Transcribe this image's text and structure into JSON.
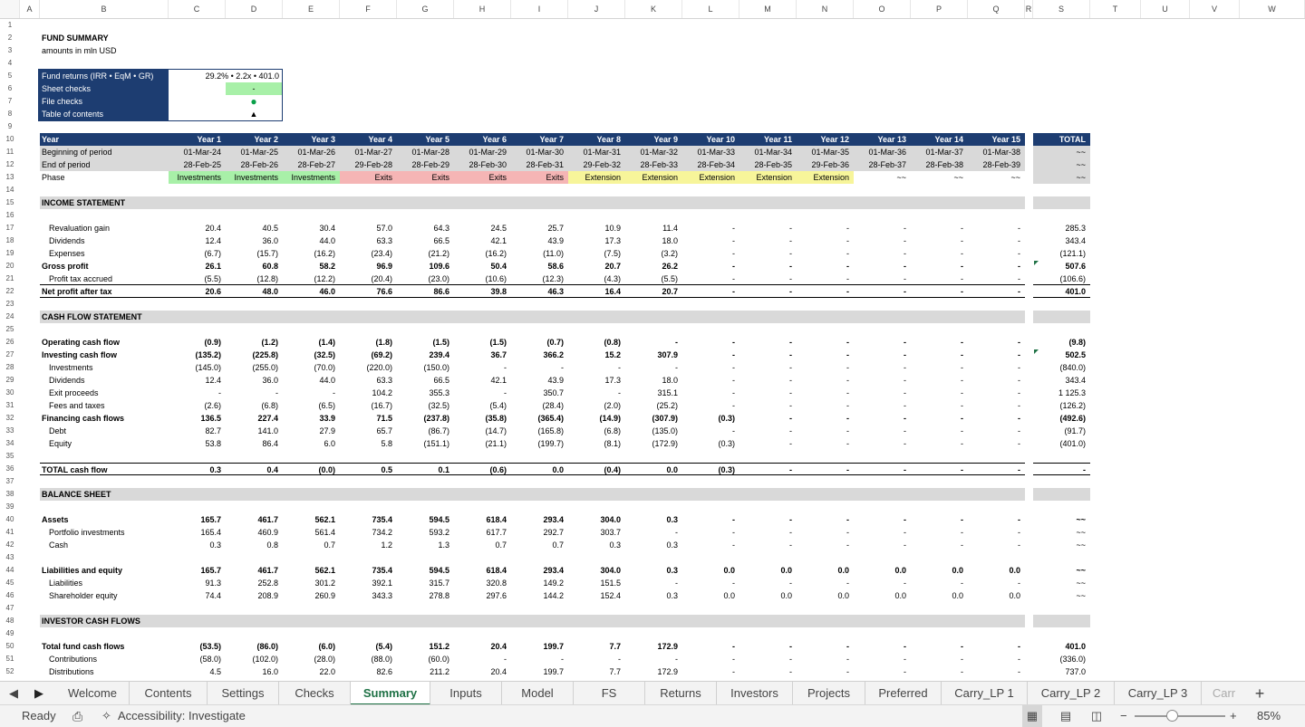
{
  "columns": [
    "A",
    "B",
    "C",
    "D",
    "E",
    "F",
    "G",
    "H",
    "I",
    "J",
    "K",
    "L",
    "M",
    "N",
    "O",
    "P",
    "Q",
    "R",
    "S",
    "T",
    "U",
    "V",
    "W"
  ],
  "title": "FUND SUMMARY",
  "subtitle": "amounts in mln USD",
  "summary_box": {
    "rows": [
      {
        "label": "Fund returns (IRR • EqM • GR)",
        "value": "29.2% • 2.2x • 401.0"
      },
      {
        "label": "Sheet checks",
        "value": "-"
      },
      {
        "label": "File checks",
        "value": "●"
      },
      {
        "label": "Table of contents",
        "value": "▲"
      }
    ]
  },
  "header": {
    "year_label": "Year",
    "years": [
      "Year 1",
      "Year 2",
      "Year 3",
      "Year 4",
      "Year 5",
      "Year 6",
      "Year 7",
      "Year 8",
      "Year 9",
      "Year 10",
      "Year 11",
      "Year 12",
      "Year 13",
      "Year 14",
      "Year 15"
    ],
    "total_label": "TOTAL",
    "bop_label": "Beginning of period",
    "bop": [
      "01-Mar-24",
      "01-Mar-25",
      "01-Mar-26",
      "01-Mar-27",
      "01-Mar-28",
      "01-Mar-29",
      "01-Mar-30",
      "01-Mar-31",
      "01-Mar-32",
      "01-Mar-33",
      "01-Mar-34",
      "01-Mar-35",
      "01-Mar-36",
      "01-Mar-37",
      "01-Mar-38"
    ],
    "eop_label": "End of period",
    "eop": [
      "28-Feb-25",
      "28-Feb-26",
      "28-Feb-27",
      "29-Feb-28",
      "28-Feb-29",
      "28-Feb-30",
      "28-Feb-31",
      "29-Feb-32",
      "28-Feb-33",
      "28-Feb-34",
      "28-Feb-35",
      "29-Feb-36",
      "28-Feb-37",
      "28-Feb-38",
      "28-Feb-39"
    ],
    "phase_label": "Phase",
    "phases": [
      "Investments",
      "Investments",
      "Investments",
      "Exits",
      "Exits",
      "Exits",
      "Exits",
      "Extension",
      "Extension",
      "Extension",
      "Extension",
      "Extension",
      "~~",
      "~~",
      "~~"
    ],
    "total_marks": [
      "~~",
      "~~",
      "~~"
    ]
  },
  "sections": {
    "income": "INCOME STATEMENT",
    "cash": "CASH FLOW STATEMENT",
    "balance": "BALANCE SHEET",
    "investor": "INVESTOR CASH FLOWS"
  },
  "lines": [
    {
      "row": 17,
      "label": "Revaluation gain",
      "indent": true,
      "vals": [
        "20.4",
        "40.5",
        "30.4",
        "57.0",
        "64.3",
        "24.5",
        "25.7",
        "10.9",
        "11.4",
        "-",
        "-",
        "-",
        "-",
        "-",
        "-"
      ],
      "total": "285.3"
    },
    {
      "row": 18,
      "label": "Dividends",
      "indent": true,
      "vals": [
        "12.4",
        "36.0",
        "44.0",
        "63.3",
        "66.5",
        "42.1",
        "43.9",
        "17.3",
        "18.0",
        "-",
        "-",
        "-",
        "-",
        "-",
        "-"
      ],
      "total": "343.4"
    },
    {
      "row": 19,
      "label": "Expenses",
      "indent": true,
      "vals": [
        "(6.7)",
        "(15.7)",
        "(16.2)",
        "(23.4)",
        "(21.2)",
        "(16.2)",
        "(11.0)",
        "(7.5)",
        "(3.2)",
        "-",
        "-",
        "-",
        "-",
        "-",
        "-"
      ],
      "total": "(121.1)"
    },
    {
      "row": 20,
      "label": "Gross profit",
      "bold": true,
      "vals": [
        "26.1",
        "60.8",
        "58.2",
        "96.9",
        "109.6",
        "50.4",
        "58.6",
        "20.7",
        "26.2",
        "-",
        "-",
        "-",
        "-",
        "-",
        "-"
      ],
      "total": "507.6"
    },
    {
      "row": 21,
      "label": "Profit tax accrued",
      "indent": true,
      "vals": [
        "(5.5)",
        "(12.8)",
        "(12.2)",
        "(20.4)",
        "(23.0)",
        "(10.6)",
        "(12.3)",
        "(4.3)",
        "(5.5)",
        "-",
        "-",
        "-",
        "-",
        "-",
        "-"
      ],
      "total": "(106.6)",
      "ul": true
    },
    {
      "row": 22,
      "label": "Net profit after tax",
      "bold": true,
      "vals": [
        "20.6",
        "48.0",
        "46.0",
        "76.6",
        "86.6",
        "39.8",
        "46.3",
        "16.4",
        "20.7",
        "-",
        "-",
        "-",
        "-",
        "-",
        "-"
      ],
      "total": "401.0",
      "ul": true
    },
    {
      "row": 26,
      "label": "Operating cash flow",
      "bold": true,
      "vals": [
        "(0.9)",
        "(1.2)",
        "(1.4)",
        "(1.8)",
        "(1.5)",
        "(1.5)",
        "(0.7)",
        "(0.8)",
        "-",
        "-",
        "-",
        "-",
        "-",
        "-",
        "-"
      ],
      "total": "(9.8)"
    },
    {
      "row": 27,
      "label": "Investing cash flow",
      "bold": true,
      "vals": [
        "(135.2)",
        "(225.8)",
        "(32.5)",
        "(69.2)",
        "239.4",
        "36.7",
        "366.2",
        "15.2",
        "307.9",
        "-",
        "-",
        "-",
        "-",
        "-",
        "-"
      ],
      "total": "502.5"
    },
    {
      "row": 28,
      "label": "Investments",
      "indent": true,
      "vals": [
        "(145.0)",
        "(255.0)",
        "(70.0)",
        "(220.0)",
        "(150.0)",
        "-",
        "-",
        "-",
        "-",
        "-",
        "-",
        "-",
        "-",
        "-",
        "-"
      ],
      "total": "(840.0)"
    },
    {
      "row": 29,
      "label": "Dividends",
      "indent": true,
      "vals": [
        "12.4",
        "36.0",
        "44.0",
        "63.3",
        "66.5",
        "42.1",
        "43.9",
        "17.3",
        "18.0",
        "-",
        "-",
        "-",
        "-",
        "-",
        "-"
      ],
      "total": "343.4"
    },
    {
      "row": 30,
      "label": "Exit proceeds",
      "indent": true,
      "vals": [
        "-",
        "-",
        "-",
        "104.2",
        "355.3",
        "-",
        "350.7",
        "-",
        "315.1",
        "-",
        "-",
        "-",
        "-",
        "-",
        "-"
      ],
      "total": "1 125.3"
    },
    {
      "row": 31,
      "label": "Fees and taxes",
      "indent": true,
      "vals": [
        "(2.6)",
        "(6.8)",
        "(6.5)",
        "(16.7)",
        "(32.5)",
        "(5.4)",
        "(28.4)",
        "(2.0)",
        "(25.2)",
        "-",
        "-",
        "-",
        "-",
        "-",
        "-"
      ],
      "total": "(126.2)"
    },
    {
      "row": 32,
      "label": "Financing cash flows",
      "bold": true,
      "vals": [
        "136.5",
        "227.4",
        "33.9",
        "71.5",
        "(237.8)",
        "(35.8)",
        "(365.4)",
        "(14.9)",
        "(307.9)",
        "(0.3)",
        "-",
        "-",
        "-",
        "-",
        "-"
      ],
      "total": "(492.6)"
    },
    {
      "row": 33,
      "label": "Debt",
      "indent": true,
      "vals": [
        "82.7",
        "141.0",
        "27.9",
        "65.7",
        "(86.7)",
        "(14.7)",
        "(165.8)",
        "(6.8)",
        "(135.0)",
        "-",
        "-",
        "-",
        "-",
        "-",
        "-"
      ],
      "total": "(91.7)"
    },
    {
      "row": 34,
      "label": "Equity",
      "indent": true,
      "vals": [
        "53.8",
        "86.4",
        "6.0",
        "5.8",
        "(151.1)",
        "(21.1)",
        "(199.7)",
        "(8.1)",
        "(172.9)",
        "(0.3)",
        "-",
        "-",
        "-",
        "-",
        "-"
      ],
      "total": "(401.0)"
    },
    {
      "row": 36,
      "label": "TOTAL cash flow",
      "bold": true,
      "top": true,
      "vals": [
        "0.3",
        "0.4",
        "(0.0)",
        "0.5",
        "0.1",
        "(0.6)",
        "0.0",
        "(0.4)",
        "0.0",
        "(0.3)",
        "-",
        "-",
        "-",
        "-",
        "-"
      ],
      "total": "-",
      "ul": true
    },
    {
      "row": 40,
      "label": "Assets",
      "bold": true,
      "vals": [
        "165.7",
        "461.7",
        "562.1",
        "735.4",
        "594.5",
        "618.4",
        "293.4",
        "304.0",
        "0.3",
        "-",
        "-",
        "-",
        "-",
        "-",
        "-"
      ],
      "total": "~~"
    },
    {
      "row": 41,
      "label": "Portfolio investments",
      "indent": true,
      "vals": [
        "165.4",
        "460.9",
        "561.4",
        "734.2",
        "593.2",
        "617.7",
        "292.7",
        "303.7",
        "-",
        "-",
        "-",
        "-",
        "-",
        "-",
        "-"
      ],
      "total": "~~"
    },
    {
      "row": 42,
      "label": "Cash",
      "indent": true,
      "vals": [
        "0.3",
        "0.8",
        "0.7",
        "1.2",
        "1.3",
        "0.7",
        "0.7",
        "0.3",
        "0.3",
        "-",
        "-",
        "-",
        "-",
        "-",
        "-"
      ],
      "total": "~~"
    },
    {
      "row": 44,
      "label": "Liabilities and equity",
      "bold": true,
      "vals": [
        "165.7",
        "461.7",
        "562.1",
        "735.4",
        "594.5",
        "618.4",
        "293.4",
        "304.0",
        "0.3",
        "0.0",
        "0.0",
        "0.0",
        "0.0",
        "0.0",
        "0.0"
      ],
      "total": "~~"
    },
    {
      "row": 45,
      "label": "Liabilities",
      "indent": true,
      "vals": [
        "91.3",
        "252.8",
        "301.2",
        "392.1",
        "315.7",
        "320.8",
        "149.2",
        "151.5",
        "-",
        "-",
        "-",
        "-",
        "-",
        "-",
        "-"
      ],
      "total": "~~"
    },
    {
      "row": 46,
      "label": "Shareholder equity",
      "indent": true,
      "vals": [
        "74.4",
        "208.9",
        "260.9",
        "343.3",
        "278.8",
        "297.6",
        "144.2",
        "152.4",
        "0.3",
        "0.0",
        "0.0",
        "0.0",
        "0.0",
        "0.0",
        "0.0"
      ],
      "total": "~~"
    },
    {
      "row": 50,
      "label": "Total fund cash flows",
      "bold": true,
      "vals": [
        "(53.5)",
        "(86.0)",
        "(6.0)",
        "(5.4)",
        "151.2",
        "20.4",
        "199.7",
        "7.7",
        "172.9",
        "-",
        "-",
        "-",
        "-",
        "-",
        "-"
      ],
      "total": "401.0"
    },
    {
      "row": 51,
      "label": "Contributions",
      "indent": true,
      "vals": [
        "(58.0)",
        "(102.0)",
        "(28.0)",
        "(88.0)",
        "(60.0)",
        "-",
        "-",
        "-",
        "-",
        "-",
        "-",
        "-",
        "-",
        "-",
        "-"
      ],
      "total": "(336.0)"
    },
    {
      "row": 52,
      "label": "Distributions",
      "indent": true,
      "vals": [
        "4.5",
        "16.0",
        "22.0",
        "82.6",
        "211.2",
        "20.4",
        "199.7",
        "7.7",
        "172.9",
        "-",
        "-",
        "-",
        "-",
        "-",
        "-"
      ],
      "total": "737.0"
    }
  ],
  "tabs": [
    "Welcome",
    "Contents",
    "Settings",
    "Checks",
    "Summary",
    "Inputs",
    "Model",
    "FS",
    "Returns",
    "Investors",
    "Projects",
    "Preferred",
    "Carry_LP 1",
    "Carry_LP 2",
    "Carry_LP 3",
    "Carr"
  ],
  "active_tab": "Summary",
  "status": {
    "ready": "Ready",
    "accessibility": "Accessibility: Investigate",
    "zoom": "85%"
  },
  "colors": {
    "navy": "#1d3d71",
    "accent": "#1e7145",
    "investments": "#a8f0a8",
    "exits": "#f5b5b5",
    "extension": "#f7f59a"
  }
}
